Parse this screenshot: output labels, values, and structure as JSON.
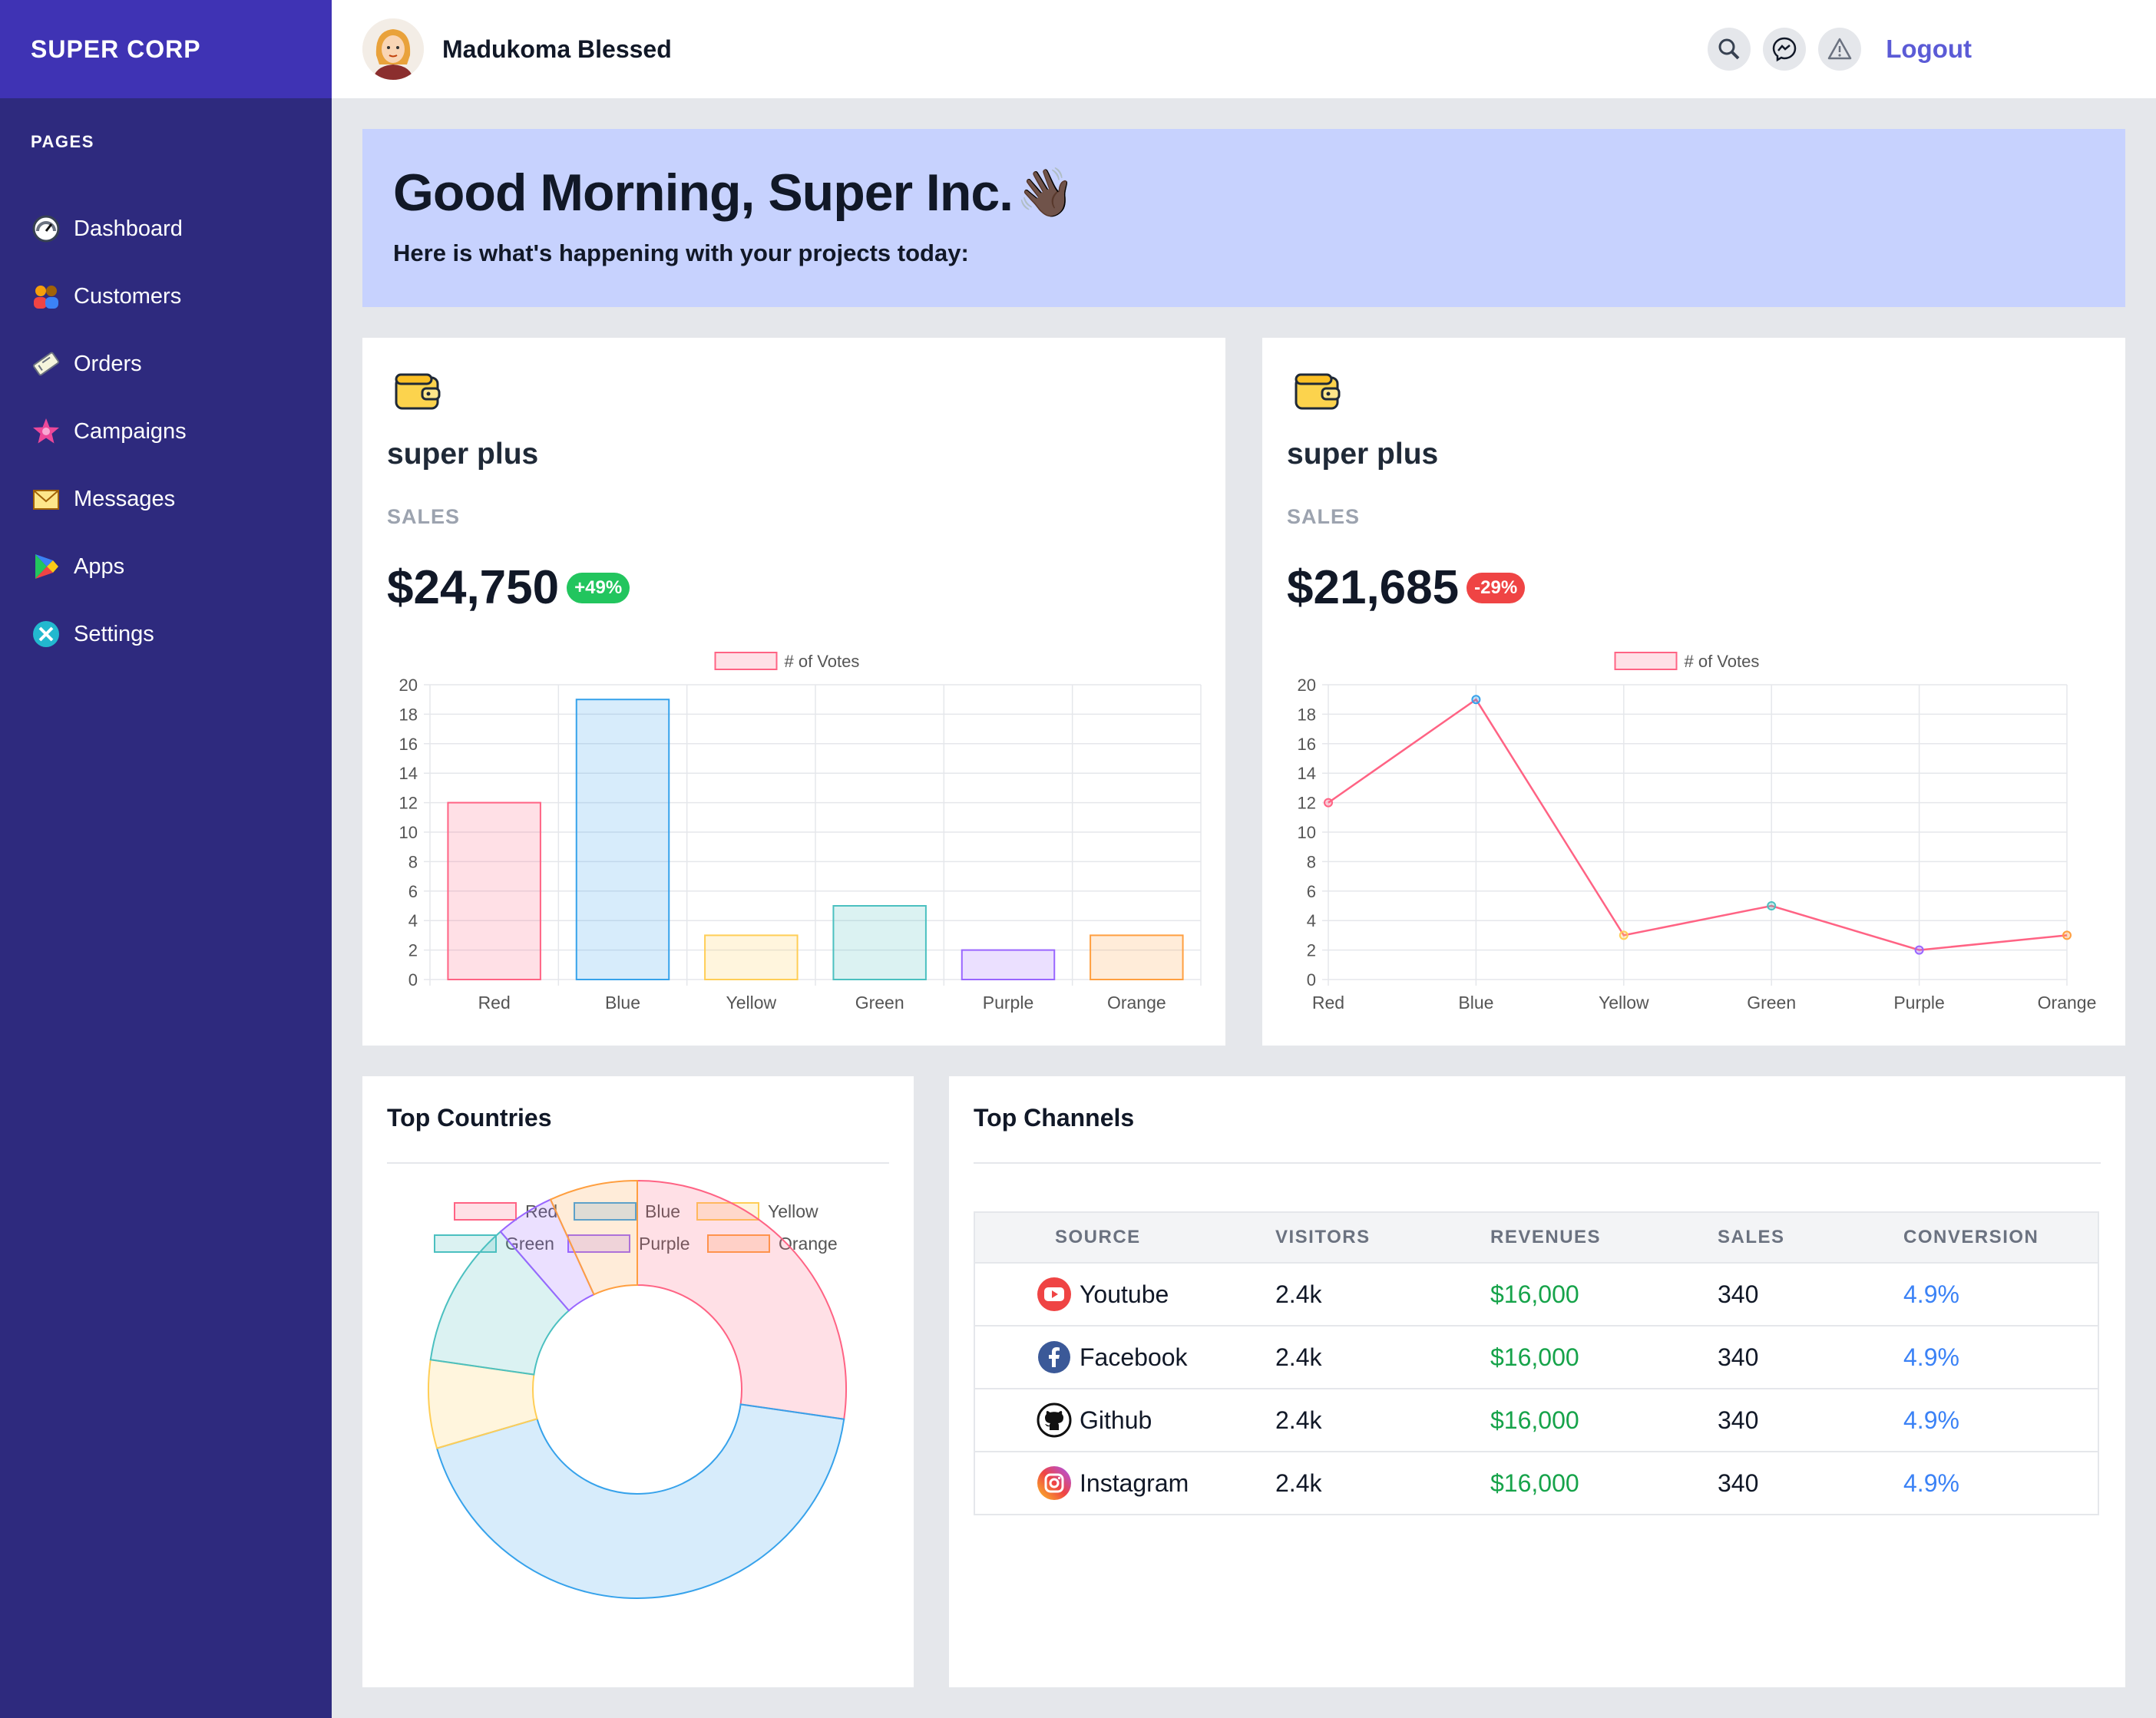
{
  "brand": "SUPER CORP",
  "sidebar": {
    "section_label": "PAGES",
    "items": [
      {
        "label": "Dashboard",
        "icon": "dashboard-icon"
      },
      {
        "label": "Customers",
        "icon": "customers-icon"
      },
      {
        "label": "Orders",
        "icon": "orders-icon"
      },
      {
        "label": "Campaigns",
        "icon": "campaigns-icon"
      },
      {
        "label": "Messages",
        "icon": "messages-icon"
      },
      {
        "label": "Apps",
        "icon": "apps-icon"
      },
      {
        "label": "Settings",
        "icon": "settings-icon"
      }
    ]
  },
  "topbar": {
    "username": "Madukoma Blessed",
    "logout_label": "Logout"
  },
  "banner": {
    "title": "Good Morning, Super Inc.",
    "title_emoji": "👋🏿",
    "subtitle": "Here is what's happening with your projects today:"
  },
  "cards": [
    {
      "title": "super plus",
      "label": "SALES",
      "value": "$24,750",
      "badge": "+49%",
      "badge_color": "#22c55e"
    },
    {
      "title": "super plus",
      "label": "SALES",
      "value": "$21,685",
      "badge": "-29%",
      "badge_color": "#ef4444"
    }
  ],
  "chart_data": [
    {
      "type": "bar",
      "legend": "# of Votes",
      "categories": [
        "Red",
        "Blue",
        "Yellow",
        "Green",
        "Purple",
        "Orange"
      ],
      "values": [
        12,
        19,
        3,
        5,
        2,
        3
      ],
      "ylim": [
        0,
        20
      ],
      "yticks": [
        0,
        2,
        4,
        6,
        8,
        10,
        12,
        14,
        16,
        18,
        20
      ],
      "colors": [
        "#ff6384",
        "#36a2eb",
        "#ffce56",
        "#4bc0c0",
        "#9966ff",
        "#ff9f40"
      ],
      "grid": true
    },
    {
      "type": "line",
      "legend": "# of Votes",
      "categories": [
        "Red",
        "Blue",
        "Yellow",
        "Green",
        "Purple",
        "Orange"
      ],
      "values": [
        12,
        19,
        3,
        5,
        2,
        3
      ],
      "ylim": [
        0,
        20
      ],
      "yticks": [
        0,
        2,
        4,
        6,
        8,
        10,
        12,
        14,
        16,
        18,
        20
      ],
      "line_color": "#ff6384",
      "point_colors": [
        "#ff6384",
        "#36a2eb",
        "#ffce56",
        "#4bc0c0",
        "#9966ff",
        "#ff9f40"
      ],
      "grid": true
    },
    {
      "type": "pie",
      "variant": "doughnut",
      "categories": [
        "Red",
        "Blue",
        "Yellow",
        "Green",
        "Purple",
        "Orange"
      ],
      "values": [
        12,
        19,
        3,
        5,
        2,
        3
      ],
      "colors": [
        "#ff6384",
        "#36a2eb",
        "#ffce56",
        "#4bc0c0",
        "#9966ff",
        "#ff9f40"
      ],
      "legend_position": "top"
    }
  ],
  "countries": {
    "title": "Top Countries"
  },
  "channels": {
    "title": "Top Channels",
    "columns": [
      "SOURCE",
      "VISITORS",
      "REVENUES",
      "SALES",
      "CONVERSION"
    ],
    "rows": [
      {
        "source": "Youtube",
        "icon": "youtube-icon",
        "visitors": "2.4k",
        "revenues": "$16,000",
        "sales": "340",
        "conversion": "4.9%"
      },
      {
        "source": "Facebook",
        "icon": "facebook-icon",
        "visitors": "2.4k",
        "revenues": "$16,000",
        "sales": "340",
        "conversion": "4.9%"
      },
      {
        "source": "Github",
        "icon": "github-icon",
        "visitors": "2.4k",
        "revenues": "$16,000",
        "sales": "340",
        "conversion": "4.9%"
      },
      {
        "source": "Instagram",
        "icon": "instagram-icon",
        "visitors": "2.4k",
        "revenues": "$16,000",
        "sales": "340",
        "conversion": "4.9%"
      }
    ],
    "revenue_color": "#16a34a",
    "conversion_color": "#3b82f6"
  }
}
